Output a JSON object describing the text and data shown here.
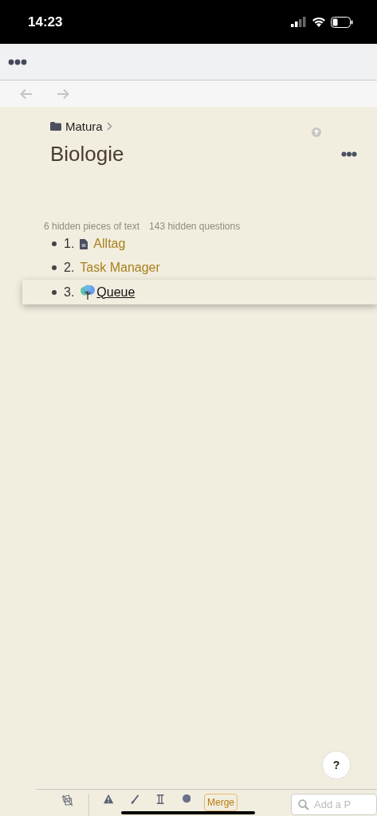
{
  "status_bar": {
    "time": "14:23"
  },
  "breadcrumb": {
    "label": "Matura"
  },
  "title": "Biologie",
  "hidden_counts": [
    "6 hidden pieces of text",
    "143 hidden questions"
  ],
  "items": [
    {
      "number": "1.",
      "label": "Alltag",
      "kind": "document",
      "selected": false
    },
    {
      "number": "2.",
      "label": "Task Manager",
      "kind": "plain",
      "selected": false
    },
    {
      "number": "3.",
      "label": "Queue",
      "kind": "tree",
      "selected": true
    }
  ],
  "help_button": "?",
  "bottom_toolbar": {
    "merge_button": "Merge",
    "search": {
      "placeholder": "Add a P"
    }
  }
}
